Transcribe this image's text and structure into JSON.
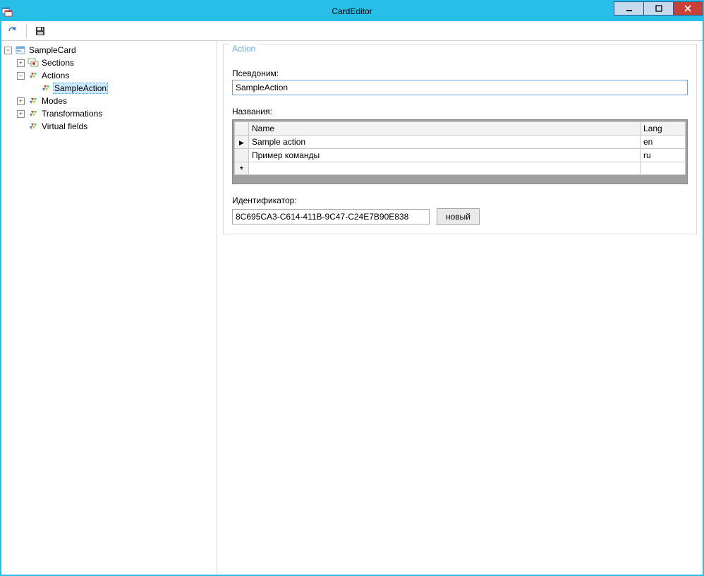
{
  "window": {
    "title": "CardEditor"
  },
  "toolbar": {
    "refresh_icon": "refresh-icon",
    "save_icon": "save-icon"
  },
  "tree": {
    "root": {
      "label": "SampleCard",
      "children": [
        {
          "label": "Sections",
          "iconType": "sections"
        },
        {
          "label": "Actions",
          "iconType": "diamond",
          "expanded": true,
          "children": [
            {
              "label": "SampleAction",
              "iconType": "diamond",
              "selected": true
            }
          ]
        },
        {
          "label": "Modes",
          "iconType": "diamond"
        },
        {
          "label": "Transformations",
          "iconType": "diamond"
        },
        {
          "label": "Virtual fields",
          "iconType": "diamond"
        }
      ]
    }
  },
  "panel": {
    "title": "Action",
    "alias_label": "Псевдоним:",
    "alias_value": "SampleAction",
    "names_label": "Названия:",
    "grid": {
      "columns": {
        "name": "Name",
        "lang": "Lang"
      },
      "rows": [
        {
          "name": "Sample action",
          "lang": "en"
        },
        {
          "name": "Пример команды",
          "lang": "ru"
        }
      ]
    },
    "id_label": "Идентификатор:",
    "id_value": "8C695CA3-C614-411B-9C47-C24E7B90E838",
    "new_button": "новый"
  }
}
